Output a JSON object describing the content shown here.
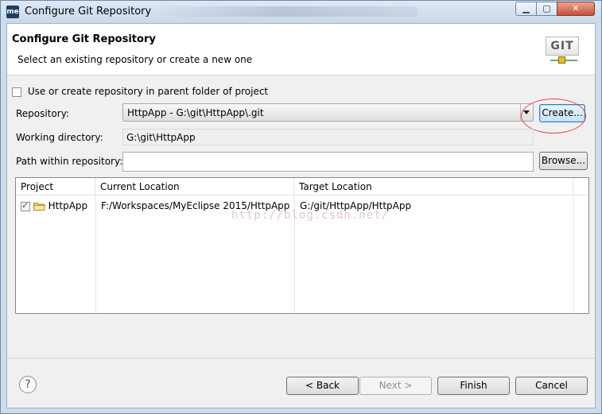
{
  "window": {
    "title": "Configure Git Repository",
    "app_icon": "me",
    "minimize_glyph": "▁",
    "maximize_glyph": "▢",
    "close_glyph": "✕"
  },
  "banner": {
    "title": "Configure Git Repository",
    "subtitle": "Select an existing repository or create a new one",
    "logo_text": "GIT"
  },
  "form": {
    "parent_folder_label": "Use or create repository in parent folder of project",
    "parent_folder_checked": false,
    "repository_label": "Repository:",
    "repository_value": "HttpApp - G:\\git\\HttpApp\\.git",
    "create_button": "Create...",
    "working_dir_label": "Working directory:",
    "working_dir_value": "G:\\git\\HttpApp",
    "path_label": "Path within repository:",
    "path_value": "",
    "browse_button": "Browse..."
  },
  "table": {
    "headers": [
      "Project",
      "Current Location",
      "Target Location"
    ],
    "rows": [
      {
        "checked": true,
        "project": "HttpApp",
        "current": "F:/Workspaces/MyEclipse 2015/HttpApp",
        "target": "G:/git/HttpApp/HttpApp"
      }
    ]
  },
  "watermark": "http://blog.csdn.net/",
  "footer": {
    "help_glyph": "?",
    "back_button": "< Back",
    "next_button": "Next >",
    "finish_button": "Finish",
    "cancel_button": "Cancel"
  },
  "colors": {
    "highlight_ellipse": "#e04848",
    "accent_focus": "#3c7fb1"
  }
}
